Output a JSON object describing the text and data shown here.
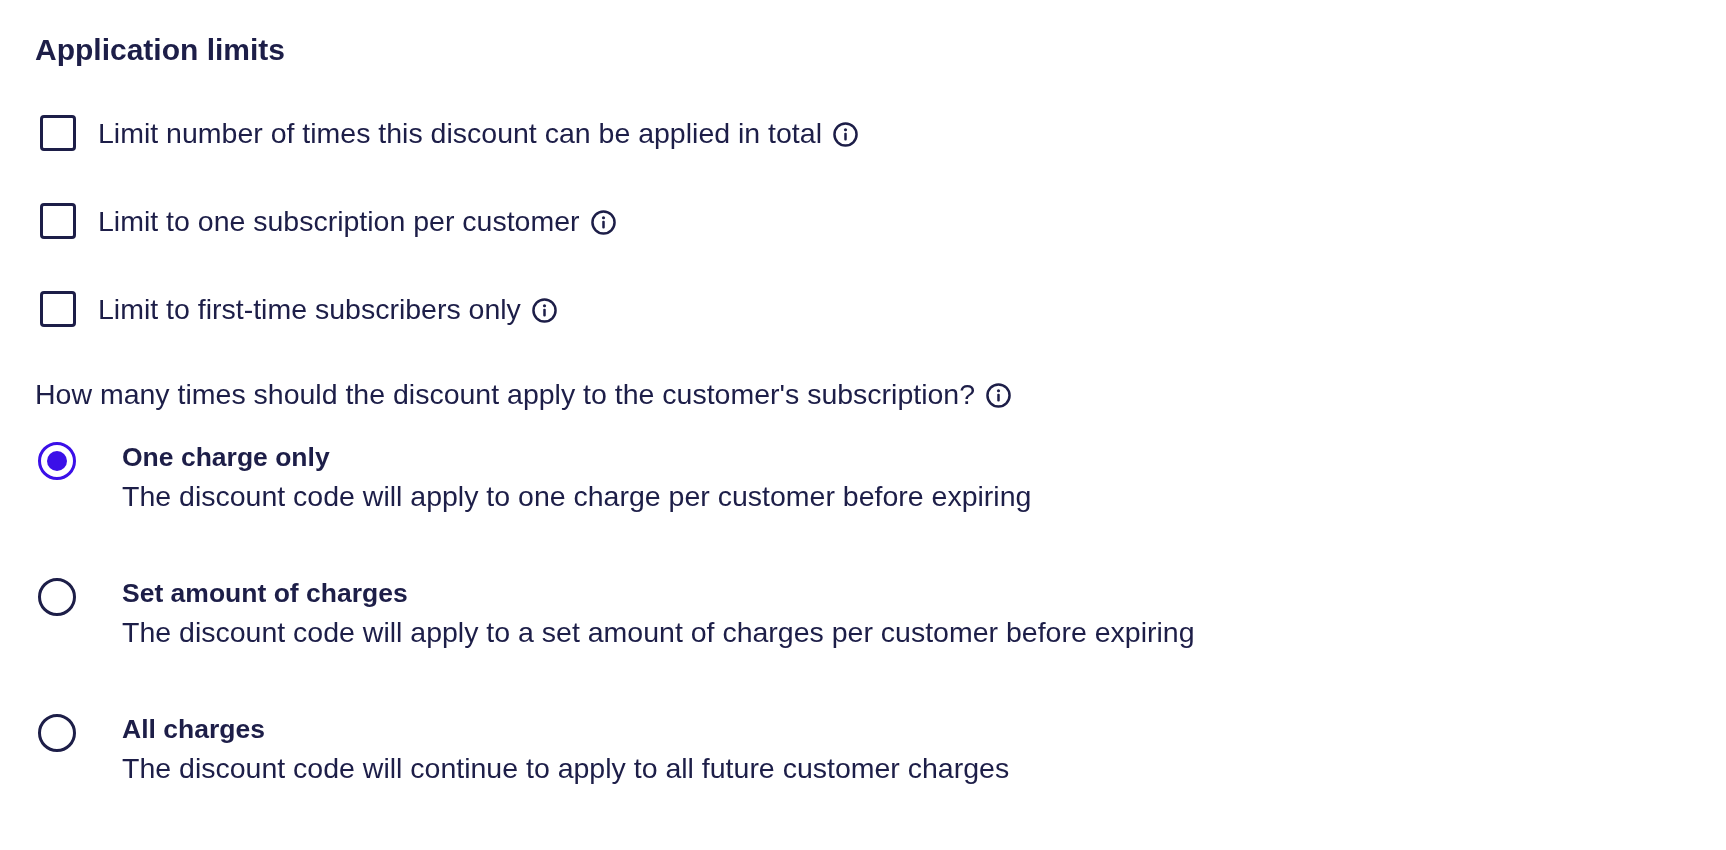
{
  "heading": "Application limits",
  "limits": [
    {
      "label": "Limit number of times this discount can be applied in total",
      "checked": false
    },
    {
      "label": "Limit to one subscription per customer",
      "checked": false
    },
    {
      "label": "Limit to first-time subscribers only",
      "checked": false
    }
  ],
  "question": "How many times should the discount apply to the customer's subscription?",
  "charge_options": [
    {
      "title": "One charge only",
      "description": "The discount code will apply to one charge per customer before expiring",
      "selected": true
    },
    {
      "title": "Set amount of charges",
      "description": "The discount code will apply to a set amount of charges per customer before expiring",
      "selected": false
    },
    {
      "title": "All charges",
      "description": "The discount code will continue to apply to all future customer charges",
      "selected": false
    }
  ]
}
